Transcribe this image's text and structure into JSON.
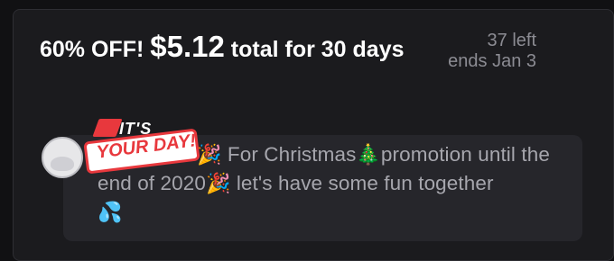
{
  "offer": {
    "title_prefix": "60% OFF! ",
    "price": "$5.12",
    "title_suffix": " total for 30 days",
    "remaining": "37 left",
    "ends": "ends Jan 3"
  },
  "message": {
    "part1": "For Christmas",
    "part2": "promotion until the end of 2020",
    "part3": " let's have some fun together",
    "emoji_party": "🎉",
    "emoji_tree": "🎄",
    "emoji_drops": "💦"
  },
  "badge": {
    "small": "IT'S",
    "main": "YOUR DAY!"
  },
  "colors": {
    "accent": "#e8383d",
    "text_primary": "#ffffff",
    "text_muted": "#a6a6ad"
  }
}
